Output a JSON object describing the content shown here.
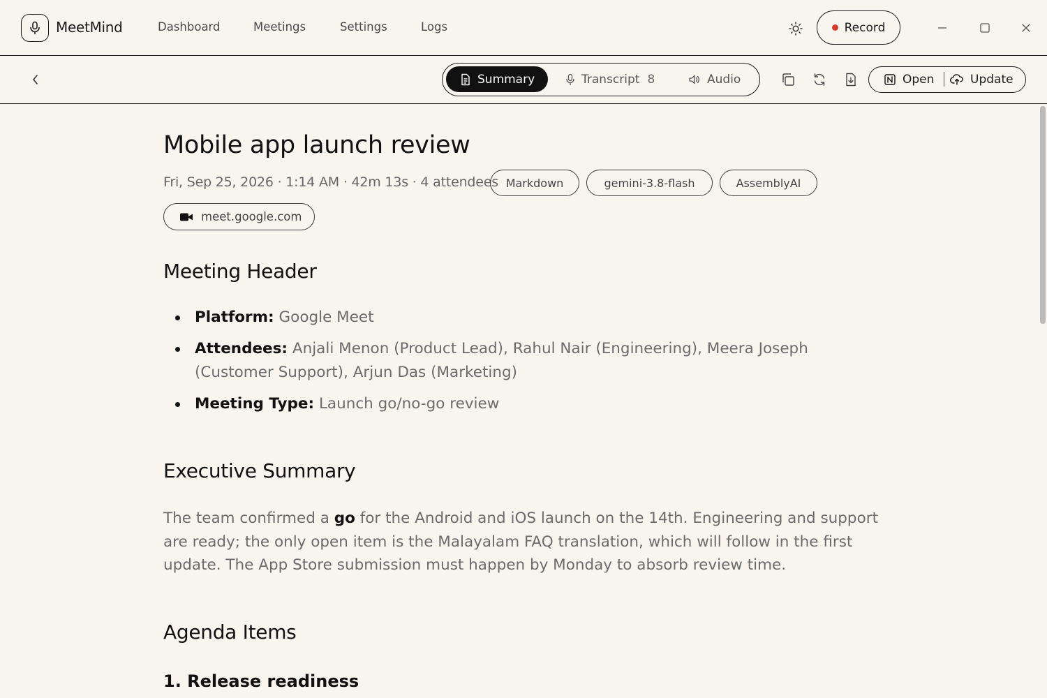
{
  "app": {
    "name": "MeetMind"
  },
  "nav": {
    "items": [
      "Dashboard",
      "Meetings",
      "Settings",
      "Logs"
    ]
  },
  "header": {
    "record_label": "Record",
    "record_color": "#d63b2c"
  },
  "toolbar": {
    "tabs": [
      {
        "label": "Summary",
        "icon": "document-icon",
        "active": true
      },
      {
        "label": "Transcript",
        "icon": "mic-icon",
        "count": "8"
      },
      {
        "label": "Audio",
        "icon": "speaker-icon"
      }
    ],
    "actions": [
      "copy-icon",
      "refresh-icon",
      "download-icon"
    ],
    "open_label": "Open",
    "update_label": "Update"
  },
  "meeting": {
    "title": "Mobile app launch review",
    "meta": "Fri, Sep 25, 2026 · 1:14 AM · 42m 13s · 4 attendees",
    "chips": [
      "Markdown",
      "gemini-3.8-flash",
      "AssemblyAI"
    ],
    "link": "meet.google.com"
  },
  "sections": {
    "header": {
      "title": "Meeting Header",
      "items": [
        {
          "label": "Platform:",
          "value": "Google Meet"
        },
        {
          "label": "Attendees:",
          "value": "Anjali Menon (Product Lead), Rahul Nair (Engineering), Meera Joseph (Customer Support), Arjun Das (Marketing)"
        },
        {
          "label": "Meeting Type:",
          "value": "Launch go/no-go review"
        }
      ]
    },
    "summary": {
      "title": "Executive Summary",
      "before": "The team confirmed a ",
      "emphasis": "go",
      "after": " for the Android and iOS launch on the 14th. Engineering and support are ready; the only open item is the Malayalam FAQ translation, which will follow in the first update. The App Store submission must happen by Monday to absorb review time."
    },
    "agenda": {
      "title": "Agenda Items",
      "first_item": "1. Release readiness"
    }
  }
}
